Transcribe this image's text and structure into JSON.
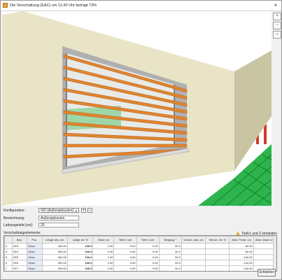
{
  "window": {
    "title": "Die Verschattung (EAC) um 11:20 Uhr beträgt  73%",
    "close_glyph": "×"
  },
  "side_tools": [
    {
      "glyph": "+"
    },
    {
      "glyph": "−"
    },
    {
      "glyph": "⌂"
    }
  ],
  "form": {
    "konfiguration_label": "Konfiguration:",
    "konfiguration_value": "ViD (Außenjalousien)",
    "add_glyph": "+",
    "remove_glyph": "−",
    "bezeichnung_label": "Bezeichnung:",
    "bezeichnung_value": "Außenjalousien",
    "laibungstiefe_label": "Laibungstiefe [cm]:",
    "laibungstiefe_value": "20",
    "elements_label": "Verschattungselemente:",
    "note": "Tiefe1 und 2 verbinden"
  },
  "table": {
    "headers": [
      "",
      "Bez.",
      "Pos.",
      "Länge abs. cm",
      "Länge rel. %",
      "Dicke cm",
      "Tiefe 1 cm",
      "Tiefe 2 cm",
      "Neigung °",
      "Versch. abs. cm",
      "Versch. rel. %",
      "Abst. Fenst. cm",
      "Abst. Wand cm"
    ],
    "rows": [
      [
        "3",
        "VE3",
        "Oben",
        "300.00",
        "100.0",
        "2.00",
        "9.00",
        "9.00",
        "30.0",
        "",
        "",
        "-60.00",
        ""
      ],
      [
        "4",
        "VE4",
        "Oben",
        "300.00",
        "100.0",
        "2.00",
        "9.00",
        "9.00",
        "30.0",
        "",
        "",
        "-80.00",
        ""
      ],
      [
        "5",
        "VE5",
        "Oben",
        "300.00",
        "100.0",
        "2.00",
        "9.00",
        "9.00",
        "30.0",
        "",
        "",
        "-100.00",
        ""
      ],
      [
        "6",
        "VE6",
        "Oben",
        "300.00",
        "100.0",
        "2.00",
        "9.00",
        "9.00",
        "30.0",
        "",
        "",
        "-120.00",
        ""
      ],
      [
        "7",
        "VE7",
        "Oben",
        "300.00",
        "100.0",
        "2.00",
        "9.00",
        "9.00",
        "30.0",
        "",
        "",
        "-140.00",
        ""
      ]
    ]
  },
  "buttons": {
    "close_label": "Schließen"
  },
  "colors": {
    "wall": "#e9e4c6",
    "wall_shade": "#c9c4a2",
    "slat": "#e0852f",
    "sky": "#ffffff",
    "grass": "#2db44e",
    "grid": "#0a7a10",
    "posts": "#d33a2a"
  }
}
